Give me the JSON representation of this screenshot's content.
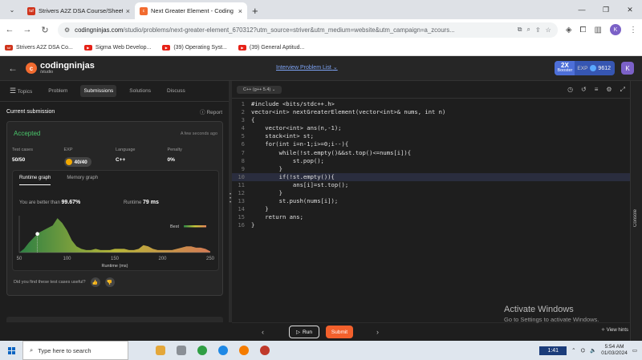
{
  "browser": {
    "tabs": [
      {
        "title": "Strivers A2Z DSA Course/Sheet",
        "active": false
      },
      {
        "title": "Next Greater Element - Coding",
        "active": true
      }
    ],
    "url_main": "codingninjas.com",
    "url_rest": "/studio/problems/next-greater-element_670312?utm_source=striver&utm_medium=website&utm_campaign=a_zcours...",
    "bookmarks": [
      "Strivers A2Z DSA Co...",
      "Sigma Web Develop...",
      "(39) Operating Syst...",
      "(39) General Aptitud..."
    ],
    "profile_initial": "K"
  },
  "header": {
    "logo_top": "codingninjas",
    "logo_bottom": "/studio",
    "interview_link": "Interview Problem List",
    "booster_x": "2X",
    "booster_label": "Booster",
    "exp_label": "EXP",
    "exp_value": "9612",
    "user_initial": "K"
  },
  "left": {
    "tabs": [
      "Topics",
      "Problem",
      "Submissions",
      "Solutions",
      "Discuss"
    ],
    "active_tab": "Submissions",
    "section_title": "Current submission",
    "report_label": "Report",
    "status": "Accepted",
    "time_ago": "A few seconds ago",
    "stats": [
      {
        "key": "Test cases",
        "value": "50/50"
      },
      {
        "key": "EXP",
        "value": "40/40"
      },
      {
        "key": "Language",
        "value": "C++"
      },
      {
        "key": "Penalty",
        "value": "0%"
      }
    ],
    "graph_tabs": [
      "Runtime graph",
      "Memory graph"
    ],
    "better_than_label": "You are better than",
    "better_than_value": "99.67%",
    "runtime_label": "Runtime",
    "runtime_value": "79 ms",
    "helpful_question": "Did you find these test cases useful?"
  },
  "chart_data": {
    "type": "area",
    "xlabel": "Runtime (ms)",
    "xticks": [
      "50",
      "100",
      "150",
      "200",
      "250"
    ],
    "xlim": [
      50,
      250
    ],
    "legend": "Best",
    "highlight_x": 69,
    "x": [
      50,
      55,
      60,
      65,
      70,
      75,
      80,
      85,
      90,
      95,
      100,
      105,
      110,
      115,
      120,
      125,
      130,
      135,
      140,
      145,
      150,
      155,
      160,
      165,
      170,
      175,
      180,
      185,
      190,
      195,
      200,
      205,
      210,
      215,
      220,
      225,
      230,
      235,
      240,
      245,
      250
    ],
    "y": [
      0,
      3,
      8,
      12,
      16,
      18,
      20,
      22,
      28,
      24,
      18,
      10,
      5,
      3,
      2,
      2,
      3,
      2,
      2,
      2,
      3,
      3,
      3,
      2,
      2,
      3,
      6,
      5,
      3,
      2,
      2,
      2,
      2,
      3,
      4,
      5,
      5,
      4,
      4,
      3,
      1
    ]
  },
  "editor": {
    "language": "C++ (g++ 5.4)",
    "lines": [
      "#include <bits/stdc++.h>",
      "vector<int> nextGreaterElement(vector<int>& nums, int n)",
      "{",
      "    vector<int> ans(n,-1);",
      "    stack<int> st;",
      "    for(int i=n-1;i>=0;i--){",
      "        while(!st.empty()&&st.top()<=nums[i]){",
      "            st.pop();",
      "        }",
      "        if(!st.empty()){",
      "            ans[i]=st.top();",
      "        }",
      "        st.push(nums[i]);",
      "    }",
      "    return ans;",
      "}"
    ],
    "highlight_line": 10,
    "run_label": "Run",
    "submit_label": "Submit",
    "hints_label": "View hints",
    "console_label": "Console"
  },
  "watermark": {
    "line1": "Activate Windows",
    "line2": "Go to Settings to activate Windows."
  },
  "taskbar": {
    "search_placeholder": "Type here to search",
    "media_time": "1:41",
    "time": "5:54 AM",
    "date": "01/03/2024"
  }
}
